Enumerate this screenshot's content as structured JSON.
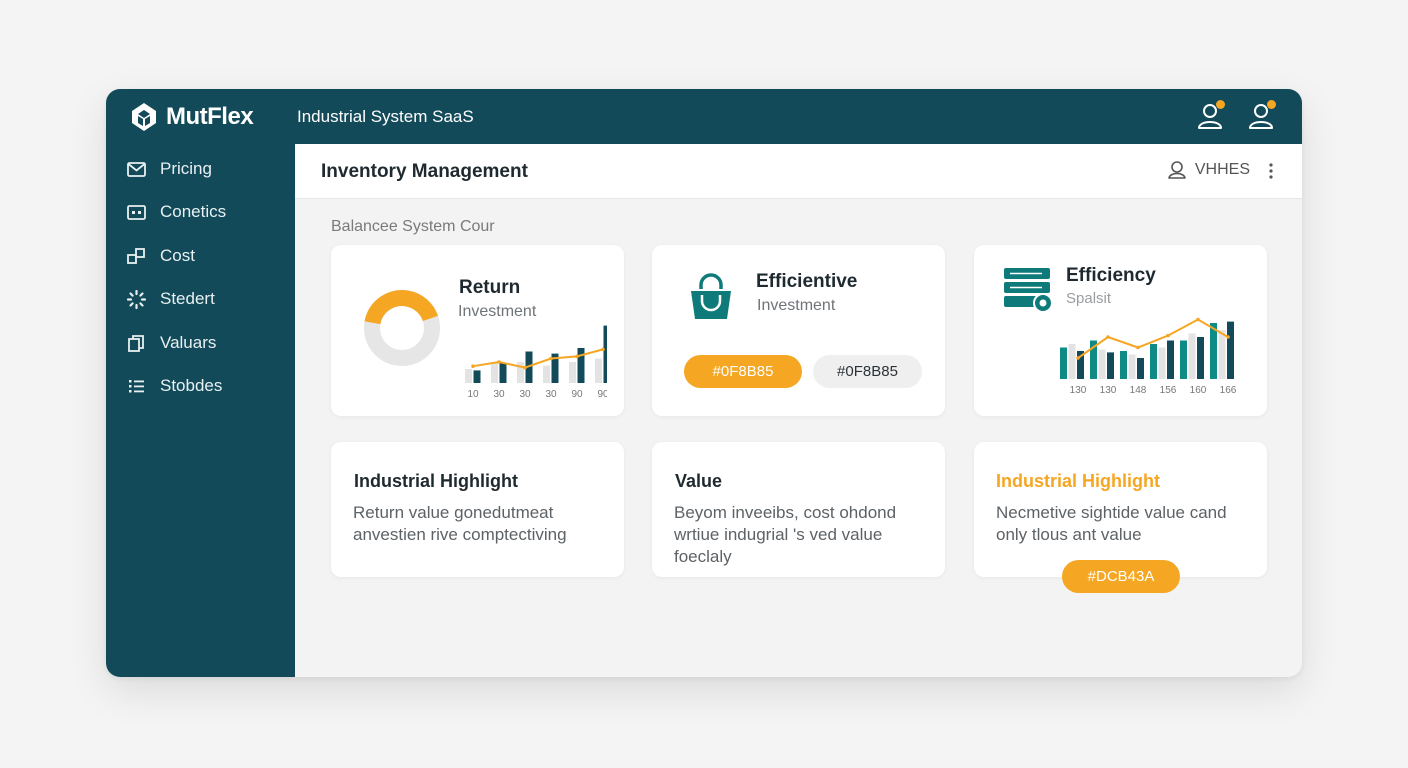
{
  "header": {
    "brand": "MutFlex",
    "app_title": "Industrial System SaaS"
  },
  "sidebar": {
    "items": [
      {
        "label": "Pricing",
        "icon": "envelope-icon"
      },
      {
        "label": "Conetics",
        "icon": "id-card-icon"
      },
      {
        "label": "Cost",
        "icon": "boxes-icon"
      },
      {
        "label": "Stedert",
        "icon": "spinner-icon"
      },
      {
        "label": "Valuars",
        "icon": "copy-icon"
      },
      {
        "label": "Stobdes",
        "icon": "list-icon"
      }
    ]
  },
  "content": {
    "page_title": "Inventory Management",
    "user_label": "VHHES",
    "section_label": "Balancee System Cour"
  },
  "cards": {
    "return": {
      "title": "Return",
      "subtitle": "Investment",
      "donut_fraction": 0.42,
      "chart_ticks": [
        "10",
        "30",
        "30",
        "30",
        "90",
        "90"
      ]
    },
    "efficientive": {
      "title": "Efficientive",
      "subtitle": "Investment",
      "pill1": "#0F8B85",
      "pill2": "#0F8B85"
    },
    "efficiency": {
      "title": "Efficiency",
      "subtitle": "Spalsit",
      "chart_ticks": [
        "130",
        "130",
        "148",
        "156",
        "160",
        "166"
      ]
    },
    "highlight1": {
      "title": "Industrial Highlight",
      "body": "Return value gonedutmeat anvestien rive comptectiving"
    },
    "value": {
      "title": "Value",
      "body": "Beyom inveeibs, cost ohdond wrtiue indugrial 's ved value foeclaly"
    },
    "highlight2": {
      "title": "Industrial Highlight",
      "body": "Necmetive sightide value cand only tlous ant value",
      "pill": "#DCB43A"
    }
  },
  "chart_data": [
    {
      "type": "bar",
      "categories": [
        "10",
        "30",
        "30",
        "30",
        "90",
        "90"
      ],
      "series": [
        {
          "values": [
            20,
            30,
            30,
            25,
            30,
            35
          ]
        },
        {
          "values": [
            18,
            28,
            45,
            42,
            50,
            82
          ]
        },
        {
          "values": [
            24,
            30,
            22,
            35,
            38,
            48
          ]
        }
      ]
    },
    {
      "type": "bar",
      "categories": [
        "130",
        "130",
        "148",
        "156",
        "160",
        "166"
      ],
      "series": [
        {
          "values": [
            45,
            55,
            40,
            50,
            55,
            80
          ]
        },
        {
          "values": [
            50,
            42,
            35,
            45,
            65,
            70
          ]
        },
        {
          "values": [
            40,
            38,
            30,
            55,
            60,
            82
          ]
        },
        {
          "values": [
            30,
            60,
            45,
            62,
            85,
            60
          ]
        }
      ]
    }
  ],
  "colors": {
    "primary": "#124a59",
    "teal": "#0f7a7a",
    "accent": "#f5a623",
    "bar_grey": "#e3e3e3",
    "bar_dark": "#124a59",
    "bar_teal": "#0f8b85"
  }
}
